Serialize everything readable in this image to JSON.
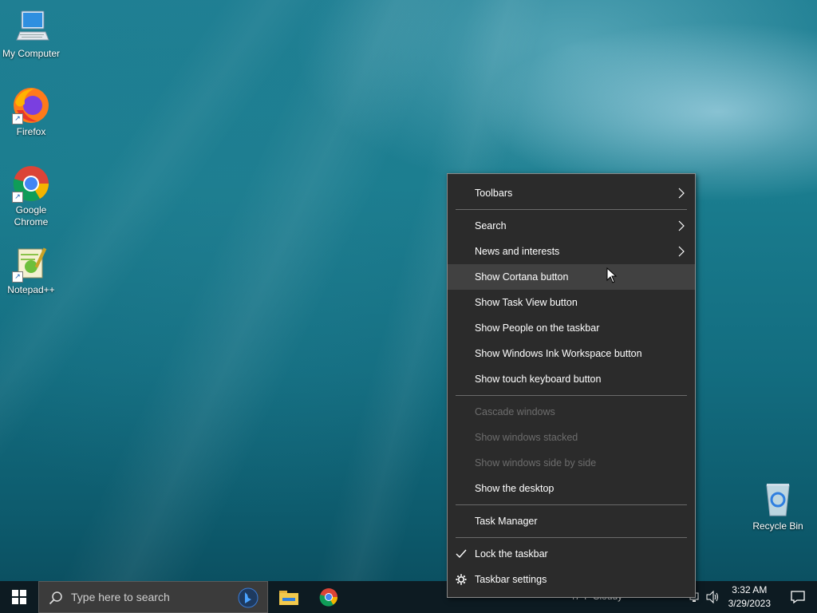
{
  "desktop": {
    "icons": [
      {
        "label": "My Computer"
      },
      {
        "label": "Firefox"
      },
      {
        "label": "Google Chrome"
      },
      {
        "label": "Notepad++"
      },
      {
        "label": "Recycle Bin"
      }
    ]
  },
  "context_menu": {
    "items": [
      {
        "label": "Toolbars",
        "submenu": true
      },
      {
        "label": "Search",
        "submenu": true
      },
      {
        "label": "News and interests",
        "submenu": true
      },
      {
        "label": "Show Cortana button",
        "state": "hover"
      },
      {
        "label": "Show Task View button"
      },
      {
        "label": "Show People on the taskbar"
      },
      {
        "label": "Show Windows Ink Workspace button"
      },
      {
        "label": "Show touch keyboard button"
      },
      {
        "label": "Cascade windows",
        "disabled": true
      },
      {
        "label": "Show windows stacked",
        "disabled": true
      },
      {
        "label": "Show windows side by side",
        "disabled": true
      },
      {
        "label": "Show the desktop"
      },
      {
        "label": "Task Manager"
      },
      {
        "label": "Lock the taskbar",
        "checked": true
      },
      {
        "label": "Taskbar settings",
        "icon": "gear-icon"
      }
    ]
  },
  "taskbar": {
    "search_placeholder": "Type here to search",
    "weather": "47°F  Cloudy",
    "time": "3:32 AM",
    "date": "3/29/2023",
    "pinned": [
      "file-explorer-icon",
      "chrome-icon"
    ]
  },
  "colors": {
    "menu_bg": "#2b2b2b",
    "menu_hover": "#414141",
    "taskbar_bg": "#0d1b22",
    "disabled_text": "#6d6d6d"
  }
}
